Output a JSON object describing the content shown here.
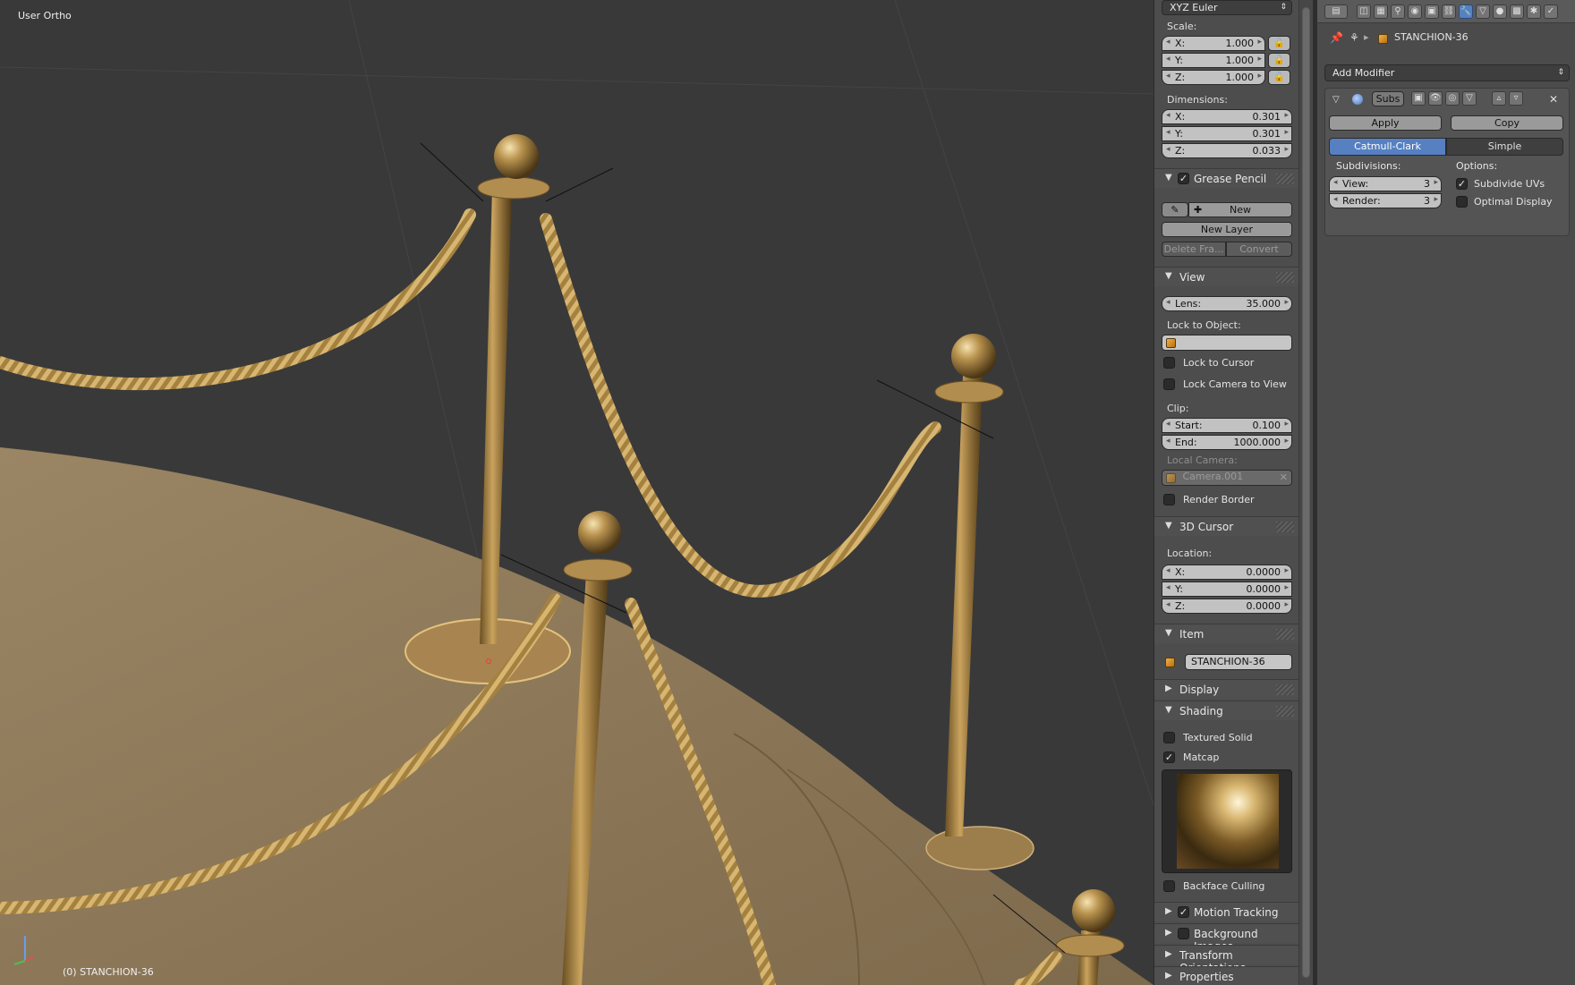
{
  "viewport": {
    "title": "User Ortho",
    "status": "(0) STANCHION-36"
  },
  "npanel": {
    "rotation_mode": "XYZ Euler",
    "scale": {
      "label": "Scale:",
      "x": {
        "label": "X:",
        "value": "1.000"
      },
      "y": {
        "label": "Y:",
        "value": "1.000"
      },
      "z": {
        "label": "Z:",
        "value": "1.000"
      }
    },
    "dimensions": {
      "label": "Dimensions:",
      "x": {
        "label": "X:",
        "value": "0.301"
      },
      "y": {
        "label": "Y:",
        "value": "0.301"
      },
      "z": {
        "label": "Z:",
        "value": "0.033"
      }
    },
    "grease_pencil": {
      "title": "Grease Pencil",
      "enabled": true,
      "new_label": "New",
      "new_layer_label": "New Layer",
      "delete_frame_label": "Delete Fra...",
      "convert_label": "Convert"
    },
    "view": {
      "title": "View",
      "lens": {
        "label": "Lens:",
        "value": "35.000"
      },
      "lock_to_object_label": "Lock to Object:",
      "lock_to_cursor_label": "Lock to Cursor",
      "lock_camera_label": "Lock Camera to View",
      "clip_label": "Clip:",
      "clip_start": {
        "label": "Start:",
        "value": "0.100"
      },
      "clip_end": {
        "label": "End:",
        "value": "1000.000"
      },
      "local_camera_label": "Local Camera:",
      "local_camera_value": "Camera.001",
      "render_border_label": "Render Border"
    },
    "cursor3d": {
      "title": "3D Cursor",
      "location_label": "Location:",
      "x": {
        "label": "X:",
        "value": "0.0000"
      },
      "y": {
        "label": "Y:",
        "value": "0.0000"
      },
      "z": {
        "label": "Z:",
        "value": "0.0000"
      }
    },
    "item": {
      "title": "Item",
      "name": "STANCHION-36"
    },
    "display": {
      "title": "Display"
    },
    "shading": {
      "title": "Shading",
      "textured_solid_label": "Textured Solid",
      "matcap_label": "Matcap",
      "matcap_checked": true,
      "backface_culling_label": "Backface Culling"
    },
    "collapsed": [
      {
        "title": "Motion Tracking",
        "checkbox": true
      },
      {
        "title": "Background Images",
        "checkbox": true
      },
      {
        "title": "Transform Orientations",
        "checkbox": false
      },
      {
        "title": "Properties",
        "checkbox": false
      }
    ]
  },
  "properties": {
    "object_name": "STANCHION-36",
    "add_modifier_label": "Add Modifier",
    "modifier": {
      "short_name": "Subs",
      "apply_label": "Apply",
      "copy_label": "Copy",
      "type_catmull": "Catmull-Clark",
      "type_simple": "Simple",
      "subdivisions_label": "Subdivisions:",
      "options_label": "Options:",
      "view": {
        "label": "View:",
        "value": "3"
      },
      "render": {
        "label": "Render:",
        "value": "3"
      },
      "subdivide_uvs_label": "Subdivide UVs",
      "subdivide_uvs_checked": true,
      "optimal_display_label": "Optimal Display",
      "optimal_display_checked": false
    }
  },
  "colors": {
    "active_blue": "#5680c2",
    "brass": "#b8924e",
    "floor": "#8f7a5a",
    "viewport_bg": "#393939"
  }
}
